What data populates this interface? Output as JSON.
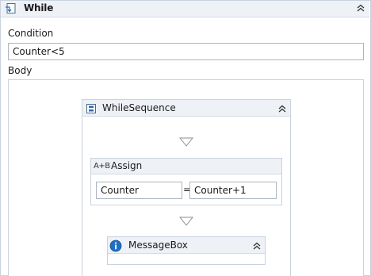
{
  "while": {
    "title": "While",
    "condition_label": "Condition",
    "condition_value": "Counter<5",
    "body_label": "Body"
  },
  "sequence": {
    "title": "WhileSequence"
  },
  "assign": {
    "icon_text": "A+B",
    "title": "Assign",
    "to_value": "Counter",
    "equals": "=",
    "value": "Counter+1"
  },
  "messagebox": {
    "title": "MessageBox"
  },
  "colors": {
    "header_bg": "#eef2f7",
    "border": "#c9d2dd",
    "input_border": "#abb5c1",
    "info_blue": "#1f6fc5"
  }
}
